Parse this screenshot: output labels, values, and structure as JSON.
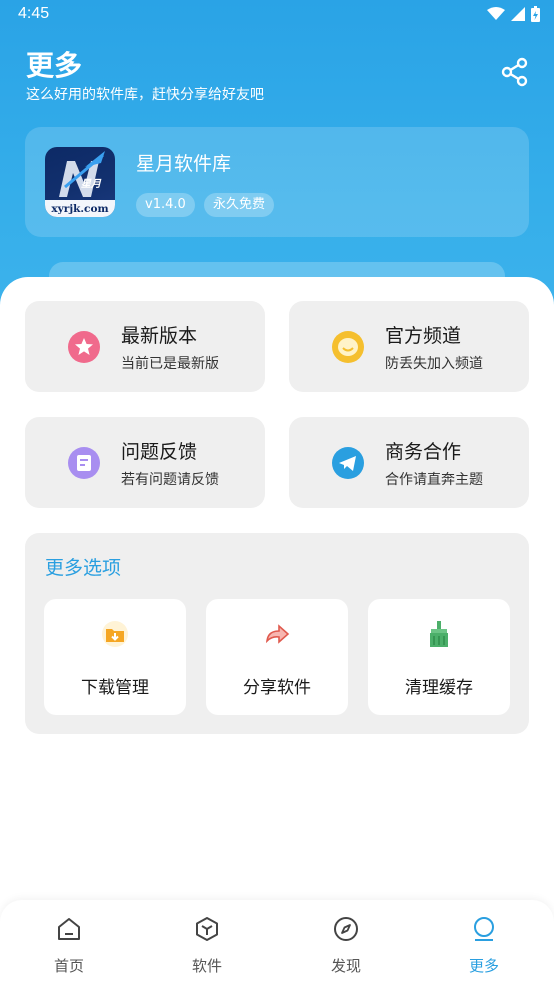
{
  "status_bar": {
    "time": "4:45"
  },
  "header": {
    "title": "更多",
    "subtitle": "这么好用的软件库，赶快分享给好友吧"
  },
  "app_card": {
    "logo_text": "星月",
    "logo_domain": "xyrjk.com",
    "name": "星月软件库",
    "version_badge": "v1.4.0",
    "free_badge": "永久免费"
  },
  "tiles": [
    {
      "title": "最新版本",
      "subtitle": "当前已是最新版",
      "icon": "star-icon",
      "color": "#f06a8c"
    },
    {
      "title": "官方频道",
      "subtitle": "防丢失加入频道",
      "icon": "chat-bubble-icon",
      "color": "#f5bf2e"
    },
    {
      "title": "问题反馈",
      "subtitle": "若有问题请反馈",
      "icon": "feedback-icon",
      "color": "#a88ef0"
    },
    {
      "title": "商务合作",
      "subtitle": "合作请直奔主题",
      "icon": "telegram-icon",
      "color": "#2a9fe0"
    }
  ],
  "more_options": {
    "title": "更多选项",
    "items": [
      {
        "label": "下载管理",
        "icon": "download-folder-icon"
      },
      {
        "label": "分享软件",
        "icon": "share-arrow-icon"
      },
      {
        "label": "清理缓存",
        "icon": "broom-icon"
      }
    ]
  },
  "bottom_nav": {
    "items": [
      {
        "label": "首页",
        "icon": "home-icon"
      },
      {
        "label": "软件",
        "icon": "cube-icon"
      },
      {
        "label": "发现",
        "icon": "compass-icon"
      },
      {
        "label": "更多",
        "icon": "more-icon",
        "active": true
      }
    ]
  },
  "colors": {
    "accent": "#2a9fe0",
    "hero_top": "#2aa3e6",
    "tile_bg": "#efefef"
  }
}
